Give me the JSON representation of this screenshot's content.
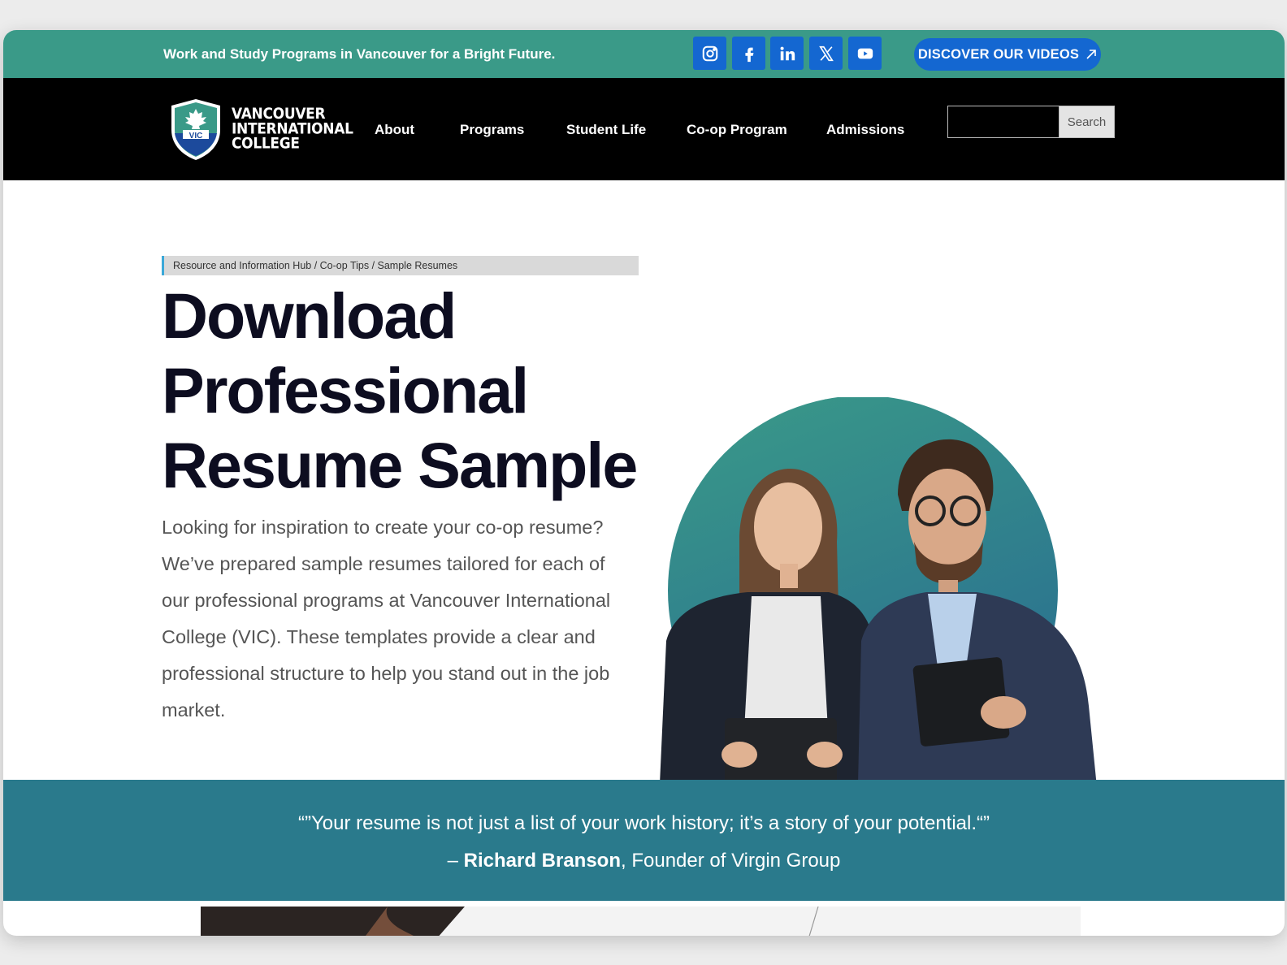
{
  "topbar": {
    "tagline": "Work and Study Programs in Vancouver for a Bright Future.",
    "social": [
      "instagram-icon",
      "facebook-icon",
      "linkedin-icon",
      "x-icon",
      "youtube-icon"
    ],
    "videos_label": "DISCOVER OUR VIDEOS",
    "videos_icon": "arrow-up-right-icon",
    "bg_color": "#3a9a88",
    "button_color": "#1467d1"
  },
  "nav": {
    "logo_lines": [
      "VANCOUVER",
      "INTERNATIONAL",
      "COLLEGE"
    ],
    "logo_badge": "VIC",
    "links": [
      "About",
      "Programs",
      "Student Life",
      "Co-op Program",
      "Admissions"
    ],
    "search_button": "Search",
    "search_placeholder": ""
  },
  "hero": {
    "breadcrumb": "Resource and Information Hub / Co-op Tips / Sample Resumes",
    "title_lines": [
      "Download",
      "Professional",
      "Resume Sample"
    ],
    "description": "Looking for inspiration to create your co-op resume? We’ve prepared sample resumes tailored for each of our professional programs at Vancouver International College (VIC). These templates provide a clear and professional structure to help you stand out in the job market."
  },
  "quote": {
    "text": "“”Your resume is not just a list of your work history; it’s a story of your potential.“”",
    "dash": "– ",
    "author": "Richard Branson",
    "role": ", Founder of Virgin Group",
    "bg_color": "#2a7a8c"
  }
}
